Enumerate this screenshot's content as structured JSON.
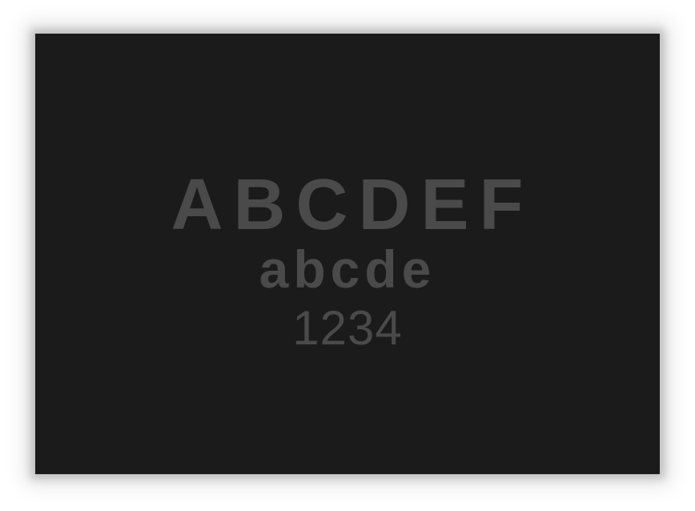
{
  "sample": {
    "uppercase": "ABCDEF",
    "lowercase": "abcde",
    "digits": "1234"
  },
  "colors": {
    "page_background": "#ffffff",
    "card_background": "#1b1b1b",
    "text": "#4a4a4a"
  }
}
